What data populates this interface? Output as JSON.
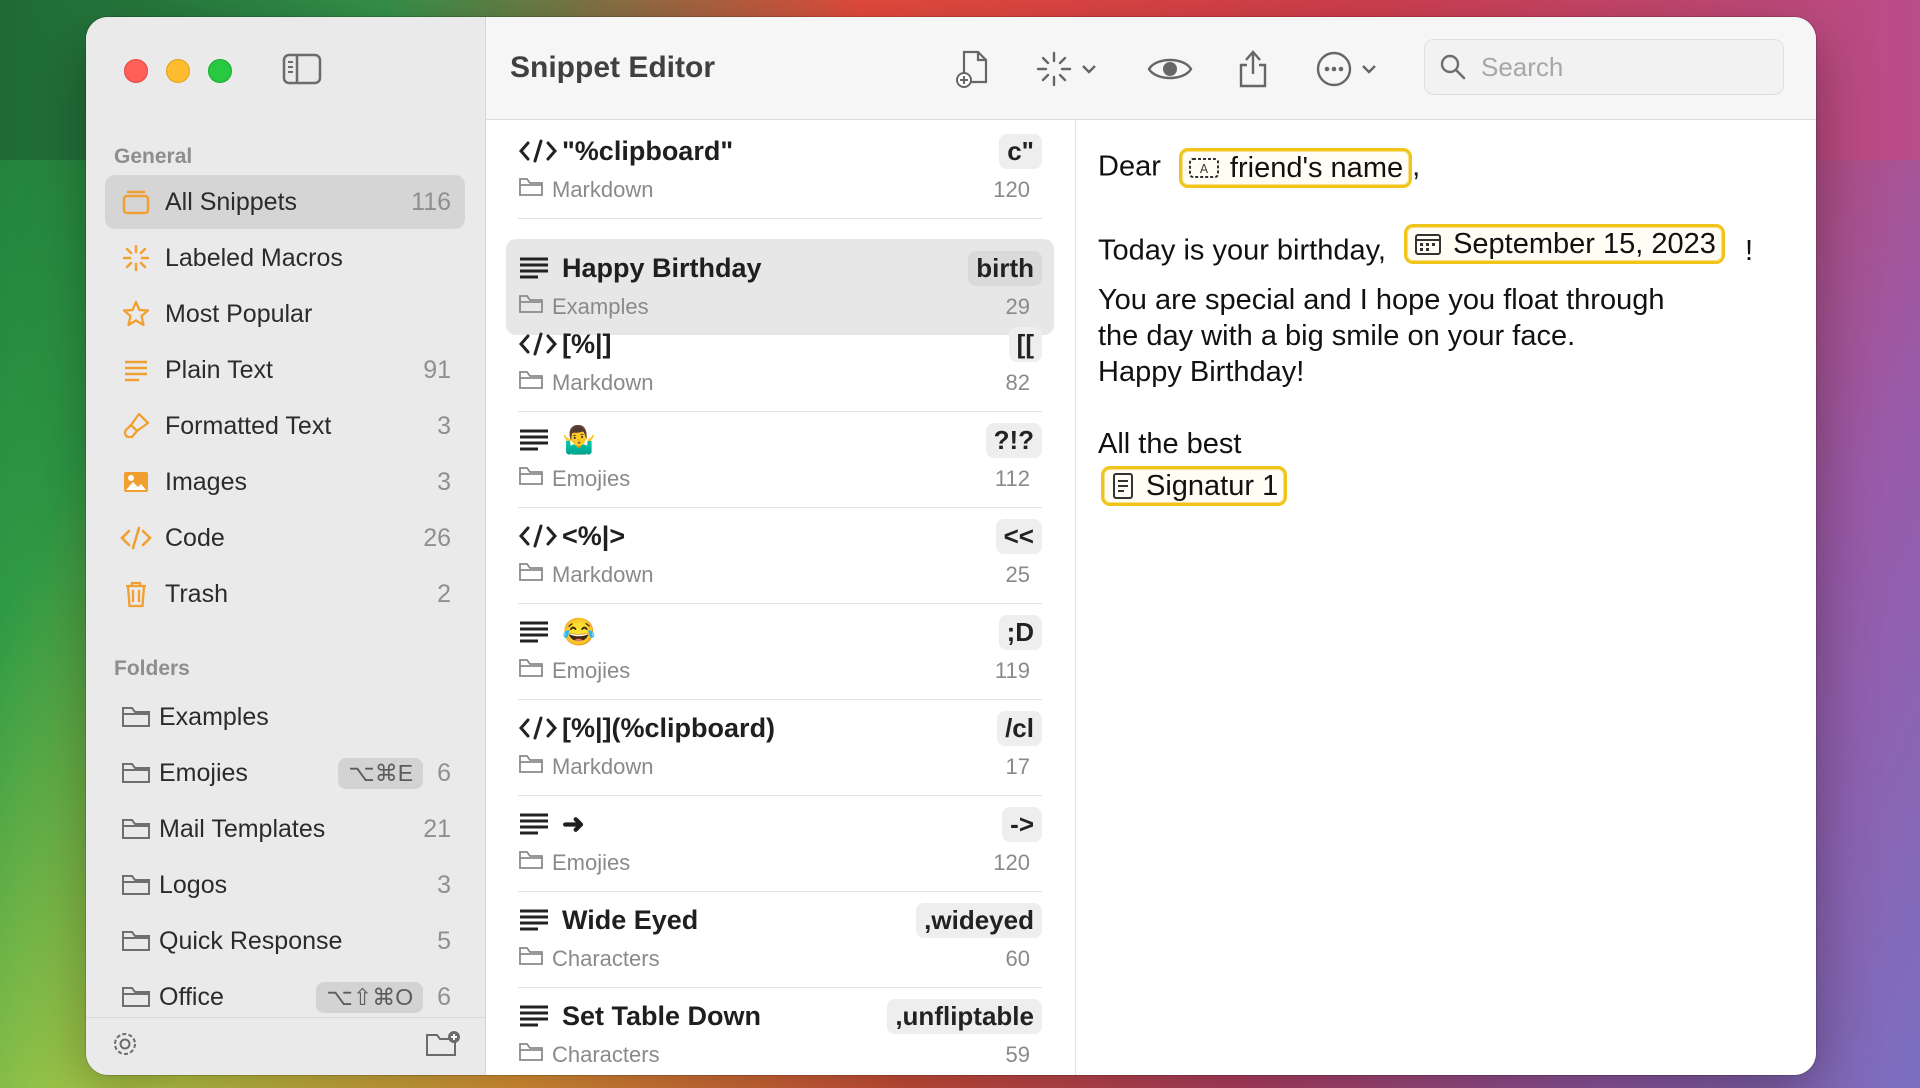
{
  "sidebar": {
    "general_label": "General",
    "folders_label": "Folders",
    "items": [
      {
        "label": "All Snippets",
        "count": "116"
      },
      {
        "label": "Labeled Macros",
        "count": ""
      },
      {
        "label": "Most Popular",
        "count": ""
      },
      {
        "label": "Plain Text",
        "count": "91"
      },
      {
        "label": "Formatted Text",
        "count": "3"
      },
      {
        "label": "Images",
        "count": "3"
      },
      {
        "label": "Code",
        "count": "26"
      },
      {
        "label": "Trash",
        "count": "2"
      }
    ],
    "folders": [
      {
        "label": "Examples",
        "shortcut": "",
        "count": ""
      },
      {
        "label": "Emojies",
        "shortcut": "⌥⌘E",
        "count": "6"
      },
      {
        "label": "Mail Templates",
        "shortcut": "",
        "count": "21"
      },
      {
        "label": "Logos",
        "shortcut": "",
        "count": "3"
      },
      {
        "label": "Quick Response",
        "shortcut": "",
        "count": "5"
      },
      {
        "label": "Office",
        "shortcut": "⌥⇧⌘O",
        "count": "6"
      }
    ]
  },
  "header": {
    "title": "Snippet Editor",
    "search_placeholder": "Search"
  },
  "snippets": [
    {
      "type": "code",
      "name": "\"%clipboard\"",
      "abbr": "c\"",
      "folder": "Markdown",
      "uses": "120"
    },
    {
      "type": "text",
      "name": "Happy Birthday",
      "abbr": "birth",
      "folder": "Examples",
      "uses": "29"
    },
    {
      "type": "code",
      "name": "[%|]",
      "abbr": "[[",
      "folder": "Markdown",
      "uses": "82"
    },
    {
      "type": "text",
      "name": "🤷‍♂️",
      "abbr": "?!?",
      "folder": "Emojies",
      "uses": "112"
    },
    {
      "type": "code",
      "name": "<%|>",
      "abbr": "<<",
      "folder": "Markdown",
      "uses": "25"
    },
    {
      "type": "text",
      "name": "😂",
      "abbr": ";D",
      "folder": "Emojies",
      "uses": "119"
    },
    {
      "type": "code",
      "name": "[%|](%clipboard)",
      "abbr": "/cl",
      "folder": "Markdown",
      "uses": "17"
    },
    {
      "type": "text",
      "name": "➜",
      "abbr": "->",
      "folder": "Emojies",
      "uses": "120"
    },
    {
      "type": "text",
      "name": "Wide Eyed",
      "abbr": ",wideyed",
      "folder": "Characters",
      "uses": "60"
    },
    {
      "type": "text",
      "name": "Set Table Down",
      "abbr": ",unfliptable",
      "folder": "Characters",
      "uses": "59"
    }
  ],
  "editor": {
    "dear": "Dear",
    "friend_token": "friend's name",
    "comma": ",",
    "today": "Today is your birthday,",
    "date_token": "September 15, 2023",
    "excl": "!",
    "line3": "You are special and I hope you float through",
    "line4": "the day with a big smile on your face.",
    "line5": "Happy Birthday!",
    "closing": "All the best",
    "signature_token": "Signatur 1"
  },
  "colors": {
    "token_border": "#f0c419",
    "accent_orange": "#f0a030",
    "selected_row": "#e7e7e7"
  }
}
